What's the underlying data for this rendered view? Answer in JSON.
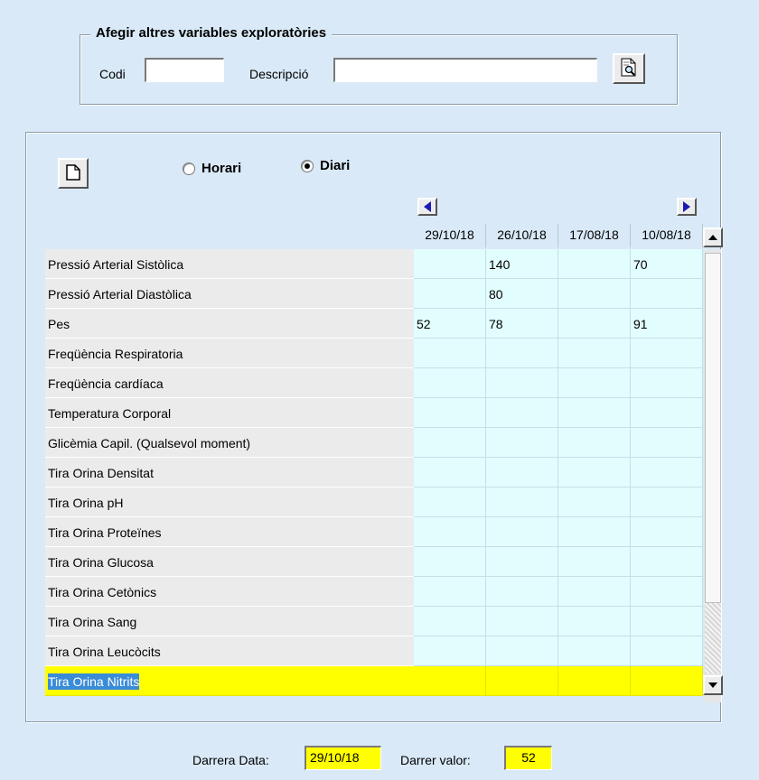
{
  "explore": {
    "title": "Afegir altres variables exploratòries",
    "code_label": "Codi",
    "code_value": "",
    "desc_label": "Descripció",
    "desc_value": ""
  },
  "mode": {
    "options": [
      {
        "label": "Horari",
        "checked": false
      },
      {
        "label": "Diari",
        "checked": true
      }
    ]
  },
  "grid": {
    "dates": [
      "29/10/18",
      "26/10/18",
      "17/08/18",
      "10/08/18"
    ],
    "rows": [
      {
        "label": "Pressió Arterial Sistòlica",
        "values": [
          "",
          "140",
          "",
          "70"
        ]
      },
      {
        "label": "Pressió Arterial Diastòlica",
        "values": [
          "",
          "80",
          "",
          ""
        ]
      },
      {
        "label": "Pes",
        "values": [
          "52",
          "78",
          "",
          "91"
        ]
      },
      {
        "label": "Freqüència Respiratoria",
        "values": [
          "",
          "",
          "",
          ""
        ]
      },
      {
        "label": "Freqüència cardíaca",
        "values": [
          "",
          "",
          "",
          ""
        ]
      },
      {
        "label": "Temperatura Corporal",
        "values": [
          "",
          "",
          "",
          ""
        ]
      },
      {
        "label": "Glicèmia Capil. (Qualsevol moment)",
        "values": [
          "",
          "",
          "",
          ""
        ]
      },
      {
        "label": "Tira Orina Densitat",
        "values": [
          "",
          "",
          "",
          ""
        ]
      },
      {
        "label": "Tira Orina pH",
        "values": [
          "",
          "",
          "",
          ""
        ]
      },
      {
        "label": "Tira Orina Proteïnes",
        "values": [
          "",
          "",
          "",
          ""
        ]
      },
      {
        "label": "Tira Orina Glucosa",
        "values": [
          "",
          "",
          "",
          ""
        ]
      },
      {
        "label": "Tira Orina Cetònics",
        "values": [
          "",
          "",
          "",
          ""
        ]
      },
      {
        "label": "Tira Orina Sang",
        "values": [
          "",
          "",
          "",
          ""
        ]
      },
      {
        "label": "Tira Orina Leucòcits",
        "values": [
          "",
          "",
          "",
          ""
        ]
      },
      {
        "label": "Tira Orina Nitrits",
        "values": [
          "",
          "",
          "",
          ""
        ],
        "selected": true
      }
    ]
  },
  "footer": {
    "last_date_label": "Darrera Data:",
    "last_date_value": "29/10/18",
    "last_value_label": "Darrer valor:",
    "last_value_value": "52"
  },
  "icons": {
    "search": "search-document-icon",
    "new": "new-document-icon",
    "prev": "arrow-left-icon",
    "next": "arrow-right-icon"
  }
}
